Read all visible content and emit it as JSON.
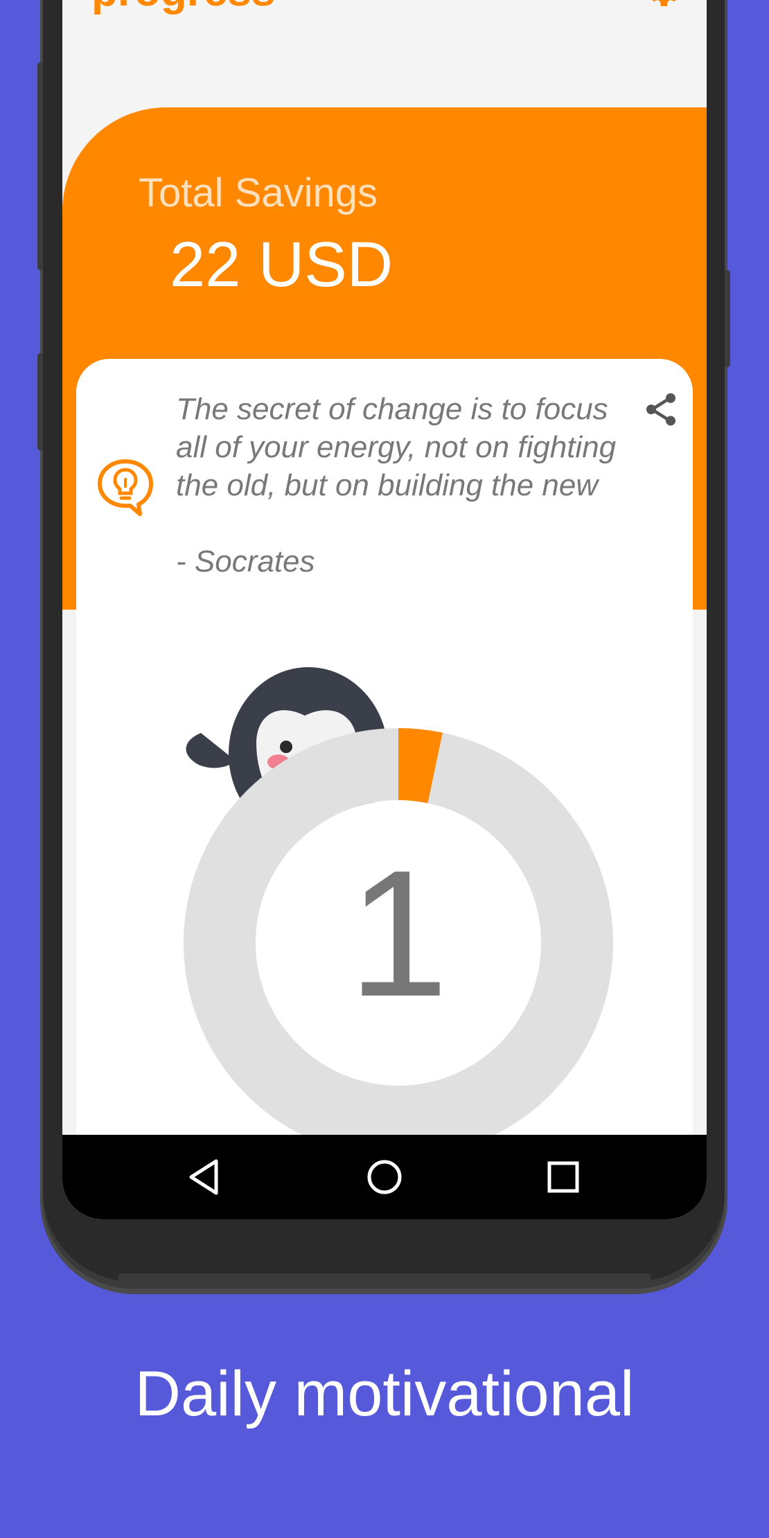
{
  "app": {
    "title": "progress"
  },
  "savings": {
    "label": "Total Savings",
    "value": "22 USD"
  },
  "quote": {
    "text": "The secret of change is to focus all of your energy, not on fighting the old, but on building the new",
    "author": "- Socrates"
  },
  "progress": {
    "number": "1",
    "fraction": 0.033
  },
  "icons": {
    "settings": "gear-icon",
    "quote": "lightbulb-speech-icon",
    "share": "share-icon",
    "mascot": "penguin-icon",
    "nav_back": "back-triangle-icon",
    "nav_home": "home-circle-icon",
    "nav_recent": "recent-square-icon"
  },
  "colors": {
    "background": "#5759db",
    "accent": "#ff8800",
    "ring_track": "#e0e0e0",
    "text_muted": "#787878"
  },
  "caption": "Daily motivational"
}
